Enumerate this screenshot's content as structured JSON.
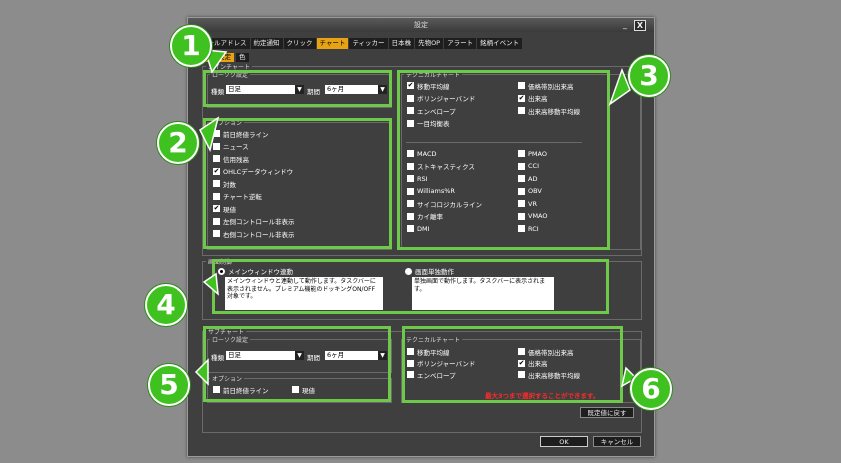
{
  "window": {
    "title": "設定",
    "minimize": "_",
    "close": "X"
  },
  "tabs": [
    {
      "label": "メールアドレス"
    },
    {
      "label": "約定通知"
    },
    {
      "label": "クリック"
    },
    {
      "label": "チャート",
      "active": true
    },
    {
      "label": "ティッカー"
    },
    {
      "label": "日本株"
    },
    {
      "label": "先物OP"
    },
    {
      "label": "アラート"
    },
    {
      "label": "銘柄イベント"
    }
  ],
  "subtabs": [
    {
      "label": "初期設定",
      "active": true
    },
    {
      "label": "色"
    }
  ],
  "main_chart": {
    "legend": "メインチャート",
    "candle": {
      "legend": "ローソク設定",
      "type_label": "種類",
      "type_value": "日足",
      "period_label": "期間",
      "period_value": "6ヶ月"
    },
    "options": {
      "legend": "オプション",
      "items": [
        {
          "label": "前日終値ライン",
          "checked": false
        },
        {
          "label": "ニュース",
          "checked": false
        },
        {
          "label": "信用残高",
          "checked": false
        },
        {
          "label": "OHLCデータウィンドウ",
          "checked": true
        },
        {
          "label": "対数",
          "checked": false
        },
        {
          "label": "チャート逆転",
          "checked": false
        },
        {
          "label": "現値",
          "checked": true
        },
        {
          "label": "左側コントロール非表示",
          "checked": false
        },
        {
          "label": "右側コントロール非表示",
          "checked": false
        }
      ]
    },
    "technical": {
      "legend": "テクニカルチャート",
      "left_top": [
        {
          "label": "移動平均線",
          "checked": true
        },
        {
          "label": "ボリンジャーバンド",
          "checked": false
        },
        {
          "label": "エンベロープ",
          "checked": false
        },
        {
          "label": "一目均衡表",
          "checked": false
        }
      ],
      "right_top": [
        {
          "label": "価格帯別出来高",
          "checked": false
        },
        {
          "label": "出来高",
          "checked": true
        },
        {
          "label": "出来高移動平均線",
          "checked": false
        }
      ],
      "left_bottom": [
        {
          "label": "MACD",
          "checked": false
        },
        {
          "label": "ストキャスティクス",
          "checked": false
        },
        {
          "label": "RSI",
          "checked": false
        },
        {
          "label": "Williams%R",
          "checked": false
        },
        {
          "label": "サイコロジカルライン",
          "checked": false
        },
        {
          "label": "カイ離率",
          "checked": false
        },
        {
          "label": "DMI",
          "checked": false
        }
      ],
      "right_bottom": [
        {
          "label": "PMAO",
          "checked": false
        },
        {
          "label": "CCI",
          "checked": false
        },
        {
          "label": "AD",
          "checked": false
        },
        {
          "label": "OBV",
          "checked": false
        },
        {
          "label": "VR",
          "checked": false
        },
        {
          "label": "VMAO",
          "checked": false
        },
        {
          "label": "RCI",
          "checked": false
        }
      ]
    }
  },
  "screen_mode": {
    "legend": "画面制御",
    "main_link": {
      "label": "メインウィンドウ連動",
      "selected": true,
      "desc": "メインウィンドウと連動して動作します。タスクバーに表示されません。プレミアム機能のドッキングON/OFF対象です。"
    },
    "single": {
      "label": "画面単独動作",
      "selected": false,
      "desc": "単独画面で動作します。タスクバーに表示されます。"
    }
  },
  "sub_chart": {
    "legend": "サブチャート",
    "candle": {
      "legend": "ローソク設定",
      "type_label": "種類",
      "type_value": "日足",
      "period_label": "期間",
      "period_value": "6ヶ月"
    },
    "options": {
      "legend": "オプション",
      "items": [
        {
          "label": "前日終値ライン",
          "checked": false
        },
        {
          "label": "現値",
          "checked": false
        }
      ]
    },
    "technical": {
      "legend": "テクニカルチャート",
      "left": [
        {
          "label": "移動平均線",
          "checked": false
        },
        {
          "label": "ボリンジャーバンド",
          "checked": false
        },
        {
          "label": "エンベロープ",
          "checked": false
        }
      ],
      "right": [
        {
          "label": "価格帯別出来高",
          "checked": false
        },
        {
          "label": "出来高",
          "checked": true
        },
        {
          "label": "出来高移動平均線",
          "checked": false
        }
      ],
      "warning": "最大3つまで選択することができます。"
    }
  },
  "buttons": {
    "reset": "既定値に戻す",
    "ok": "OK",
    "cancel": "キャンセル"
  },
  "callouts": [
    "1",
    "2",
    "3",
    "4",
    "5",
    "6"
  ],
  "colors": {
    "highlight": "#6ec84a",
    "callout": "#3fc21f",
    "active_tab": "#e8a314",
    "warning": "#ff2a2a"
  }
}
